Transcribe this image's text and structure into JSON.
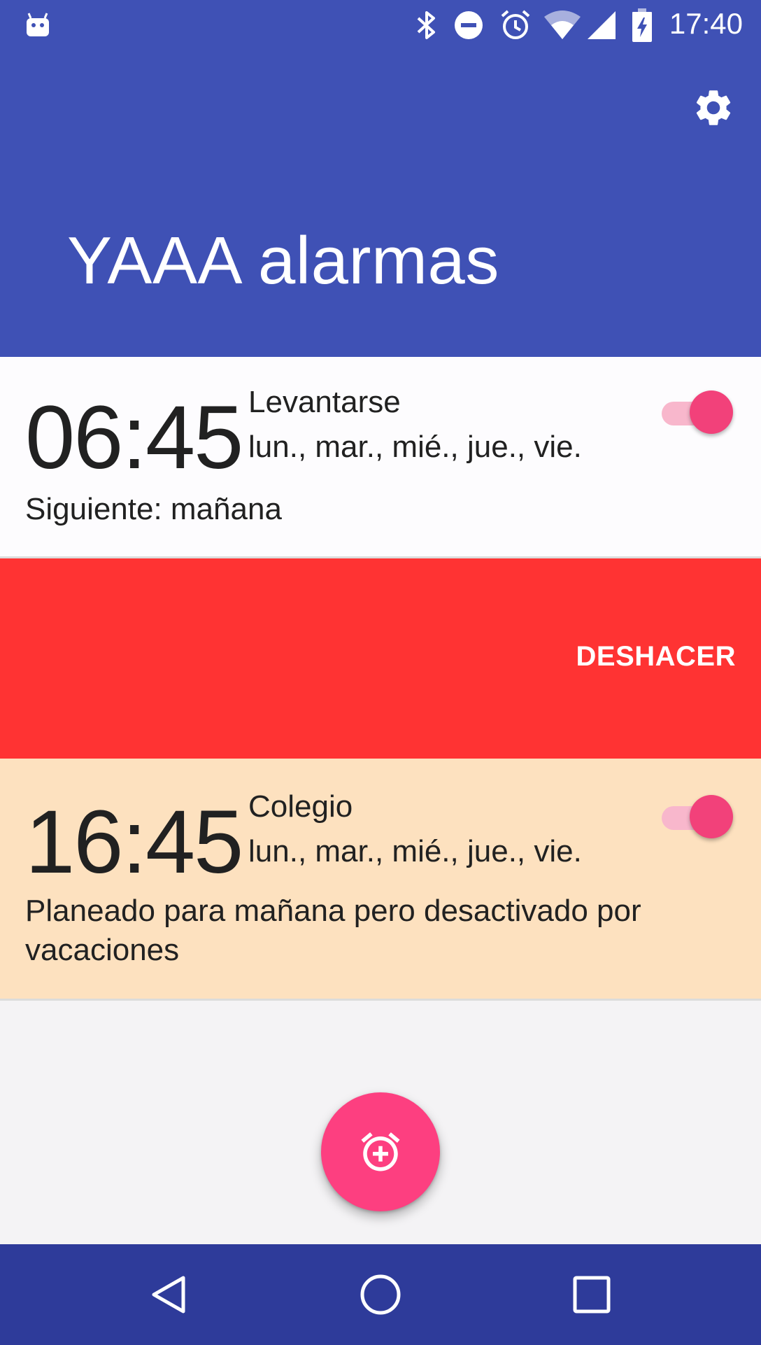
{
  "status_bar": {
    "time": "17:40",
    "icons": [
      "android-icon",
      "bluetooth-icon",
      "do-not-disturb-icon",
      "alarm-icon",
      "wifi-icon",
      "signal-icon",
      "battery-charging-icon"
    ]
  },
  "header": {
    "title": "YAAA alarmas",
    "settings_icon": "gear-icon"
  },
  "alarms": [
    {
      "time": "06:45",
      "name": "Levantarse",
      "days": "lun., mar., mié., jue., vie.",
      "note": "Siguiente: mañana",
      "enabled": true,
      "background": "#fdfcfe"
    },
    {
      "time": "16:45",
      "name": "Colegio",
      "days": "lun., mar., mié., jue., vie.",
      "note": "Planeado para mañana pero desactivado por vacaciones",
      "enabled": true,
      "background": "#fde1bf"
    }
  ],
  "undo_bar": {
    "label": "DESHACER",
    "background": "#ff3333"
  },
  "fab": {
    "icon": "add-alarm-icon",
    "color": "#fd3f80"
  },
  "nav": {
    "icons": [
      "back-icon",
      "home-icon",
      "recents-icon"
    ]
  },
  "colors": {
    "primary": "#3f51b5",
    "primary_dark": "#2e3b9a",
    "accent": "#f2417a"
  }
}
